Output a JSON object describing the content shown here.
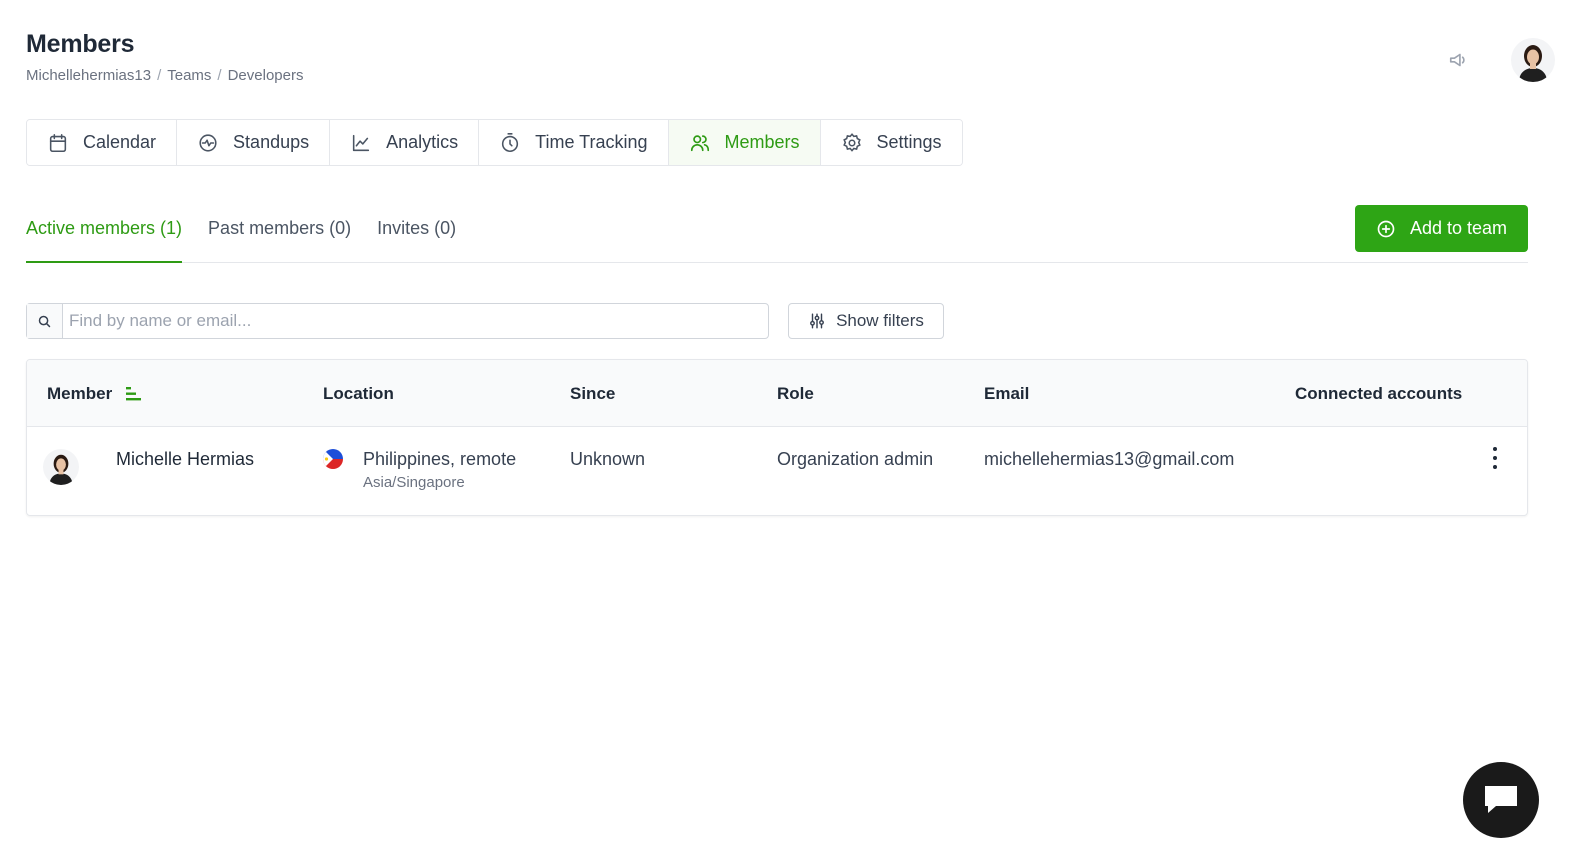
{
  "header": {
    "title": "Members",
    "breadcrumb": [
      "Michellehermias13",
      "Teams",
      "Developers"
    ],
    "breadcrumb_separator": "/"
  },
  "nav_tabs": [
    {
      "label": "Calendar",
      "icon": "calendar-icon",
      "active": false
    },
    {
      "label": "Standups",
      "icon": "standups-icon",
      "active": false
    },
    {
      "label": "Analytics",
      "icon": "analytics-icon",
      "active": false
    },
    {
      "label": "Time Tracking",
      "icon": "stopwatch-icon",
      "active": false
    },
    {
      "label": "Members",
      "icon": "users-icon",
      "active": true
    },
    {
      "label": "Settings",
      "icon": "gear-icon",
      "active": false
    }
  ],
  "sub_tabs": [
    {
      "label": "Active members (1)",
      "active": true
    },
    {
      "label": "Past members (0)",
      "active": false
    },
    {
      "label": "Invites (0)",
      "active": false
    }
  ],
  "add_button": {
    "label": "Add to team",
    "icon": "plus-circle-icon"
  },
  "search": {
    "placeholder": "Find by name or email...",
    "value": ""
  },
  "filter_button": {
    "label": "Show filters",
    "icon": "sliders-icon"
  },
  "table": {
    "columns": [
      "Member",
      "Location",
      "Since",
      "Role",
      "Email",
      "Connected accounts"
    ],
    "rows": [
      {
        "name": "Michelle Hermias",
        "location": "Philippines, remote",
        "timezone": "Asia/Singapore",
        "since": "Unknown",
        "role": "Organization admin",
        "email": "michellehermias13@gmail.com",
        "connected_accounts": ""
      }
    ]
  },
  "colors": {
    "accent": "#2e9b14",
    "button": "#2ea515",
    "text": "#1f2937",
    "muted": "#6b7280",
    "border": "#e5e7eb"
  }
}
